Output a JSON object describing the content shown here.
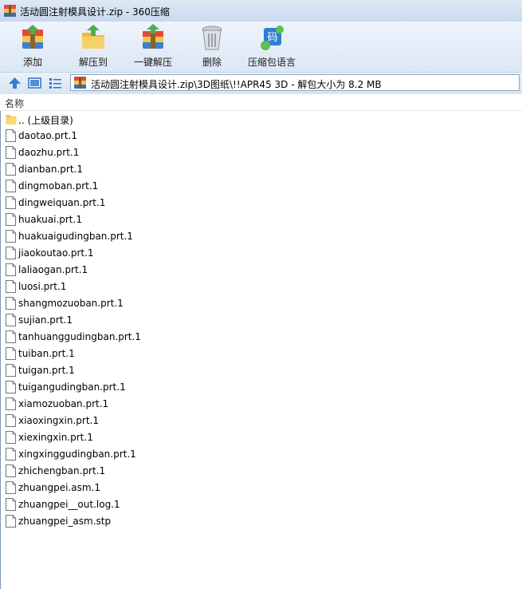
{
  "window": {
    "title": "活动圆注射模具设计.zip - 360压缩"
  },
  "toolbar": {
    "buttons": [
      {
        "label": "添加",
        "icon": "add-archive-icon"
      },
      {
        "label": "解压到",
        "icon": "extract-to-icon"
      },
      {
        "label": "一键解压",
        "icon": "one-click-extract-icon"
      },
      {
        "label": "删除",
        "icon": "delete-icon"
      },
      {
        "label": "压缩包语言",
        "icon": "archive-language-icon"
      }
    ],
    "language_icon_glyph": "码"
  },
  "navbar": {
    "path": "活动圆注射模具设计.zip\\3D图纸\\!!APR45 3D - 解包大小为 8.2 MB",
    "icons": [
      "up-arrow-icon",
      "large-icons-view-icon",
      "list-view-icon"
    ]
  },
  "list": {
    "column_name": "名称",
    "parent_dir": ".. (上级目录)",
    "files": [
      "daotao.prt.1",
      "daozhu.prt.1",
      "dianban.prt.1",
      "dingmoban.prt.1",
      "dingweiquan.prt.1",
      "huakuai.prt.1",
      "huakuaigudingban.prt.1",
      "jiaokoutao.prt.1",
      "laliaogan.prt.1",
      "luosi.prt.1",
      "shangmozuoban.prt.1",
      "sujian.prt.1",
      "tanhuanggudingban.prt.1",
      "tuiban.prt.1",
      "tuigan.prt.1",
      "tuigangudingban.prt.1",
      "xiamozuoban.prt.1",
      "xiaoxingxin.prt.1",
      "xiexingxin.prt.1",
      "xingxinggudingban.prt.1",
      "zhichengban.prt.1",
      "zhuangpei.asm.1",
      "zhuangpei__out.log.1",
      "zhuangpei_asm.stp"
    ]
  },
  "colors": {
    "titlebar_top": "#dfe9f5",
    "toolbar_bg": "#dbe7f5",
    "folder": "#f2c14e",
    "address_border": "#8ea7c4"
  }
}
